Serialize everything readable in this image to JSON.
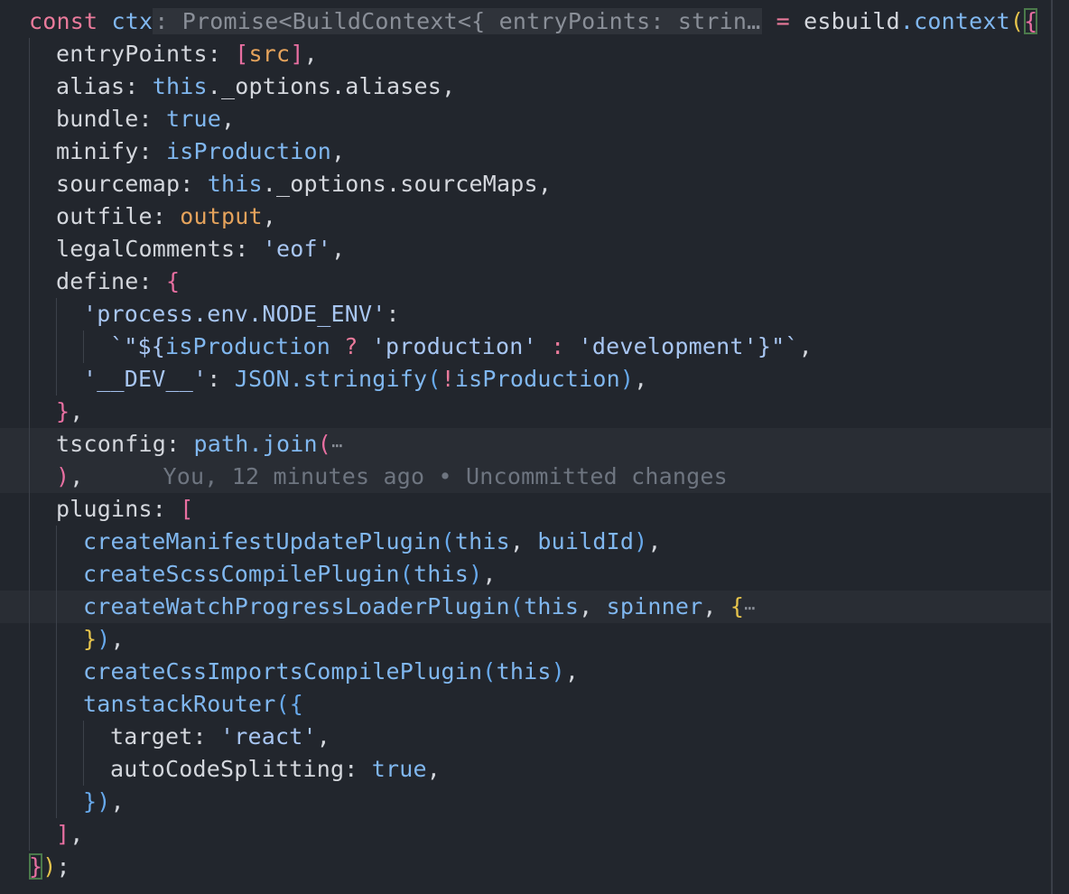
{
  "colors": {
    "background": "#22262d",
    "keyword": "#ea7a9b",
    "function": "#80b7ef",
    "string": "#a8c6f2",
    "param": "#e5a35c"
  },
  "inlay_hint": ": Promise<BuildContext<{ entryPoints: strin…",
  "fold_marker": "⋯",
  "blame": "You, 12 minutes ago • Uncommitted changes",
  "tokens": {
    "const": "const",
    "ctx": "ctx",
    "eq": " = ",
    "esbuild": "esbuild",
    "context_call": ".context",
    "entryPoints": "entryPoints: ",
    "src": "src",
    "alias": "alias: ",
    "this": "this",
    "options_aliases": "._options.aliases",
    "bundle": "bundle: ",
    "true": "true",
    "minify": "minify: ",
    "isProduction": "isProduction",
    "sourcemap": "sourcemap: ",
    "options_sourceMaps": "._options.sourceMaps",
    "outfile": "outfile: ",
    "output": "output",
    "legalComments": "legalComments: ",
    "eof": "'eof'",
    "define": "define: ",
    "node_env_key": "'process.env.NODE_ENV'",
    "tpl_open": "`\"${",
    "ternary_q": " ? ",
    "production": "'production'",
    "ternary_c": " : ",
    "development": "'development'",
    "tpl_close": "}\"`",
    "dev_key": "'__DEV__'",
    "JSON": "JSON",
    "stringify": ".stringify",
    "not": "!",
    "tsconfig": "tsconfig: ",
    "path": "path",
    "join": ".join",
    "plugins": "plugins: ",
    "createManifestUpdatePlugin": "createManifestUpdatePlugin",
    "buildId": "buildId",
    "createScssCompilePlugin": "createScssCompilePlugin",
    "createWatchProgressLoaderPlugin": "createWatchProgressLoaderPlugin",
    "spinner": "spinner",
    "createCssImportsCompilePlugin": "createCssImportsCompilePlugin",
    "tanstackRouter": "tanstackRouter",
    "target": "target: ",
    "react": "'react'",
    "autoCodeSplitting": "autoCodeSplitting: "
  }
}
